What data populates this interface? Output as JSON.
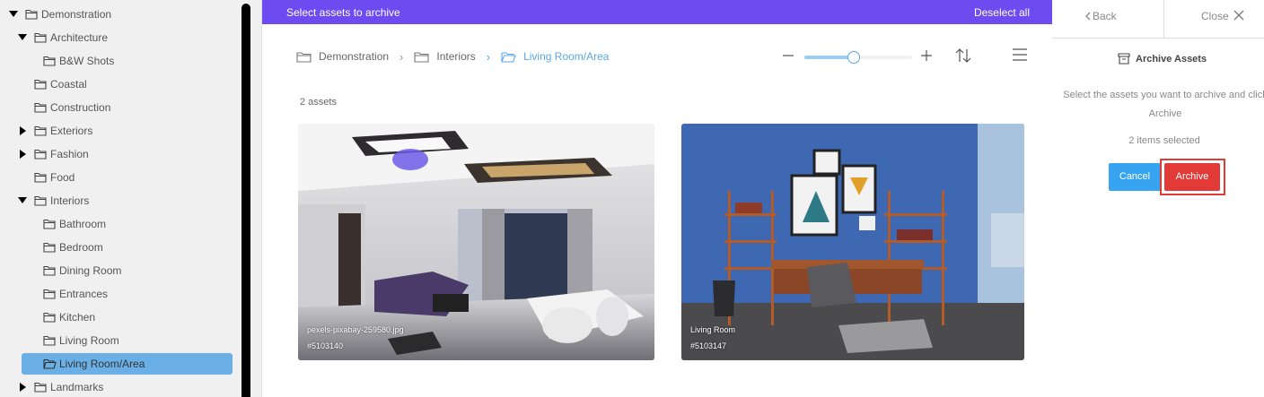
{
  "tree": {
    "items": [
      {
        "label": "Demonstration",
        "caret": "down"
      },
      {
        "label": "Architecture",
        "caret": "down"
      },
      {
        "label": "B&W Shots",
        "caret": ""
      },
      {
        "label": "Coastal",
        "caret": ""
      },
      {
        "label": "Construction",
        "caret": ""
      },
      {
        "label": "Exteriors",
        "caret": "right"
      },
      {
        "label": "Fashion",
        "caret": "right"
      },
      {
        "label": "Food",
        "caret": ""
      },
      {
        "label": "Interiors",
        "caret": "down"
      },
      {
        "label": "Bathroom",
        "caret": ""
      },
      {
        "label": "Bedroom",
        "caret": ""
      },
      {
        "label": "Dining Room",
        "caret": ""
      },
      {
        "label": "Entrances",
        "caret": ""
      },
      {
        "label": "Kitchen",
        "caret": ""
      },
      {
        "label": "Living Room",
        "caret": ""
      },
      {
        "label": "Living Room/Area",
        "caret": "",
        "selected": true
      },
      {
        "label": "Landmarks",
        "caret": "right"
      }
    ]
  },
  "topbar": {
    "title": "Select assets to archive",
    "deselect": "Deselect all",
    "color": "#6c4cf0"
  },
  "breadcrumb": [
    {
      "label": "Demonstration"
    },
    {
      "label": "Interiors"
    },
    {
      "label": "Living Room/Area",
      "active": true
    }
  ],
  "zoom": {
    "level": 0.45
  },
  "asset_count": "2 assets",
  "assets": [
    {
      "name": "pexels-pixabay-259580.jpg",
      "id": "#5103140",
      "selected": true
    },
    {
      "name": "Living Room",
      "id": "#5103147",
      "selected": true
    }
  ],
  "right": {
    "back": "Back",
    "close": "Close",
    "title": "Archive Assets",
    "instructions": "Select the assets you want to archive and click Archive",
    "selected": "2 items selected",
    "cancel": "Cancel",
    "archive": "Archive",
    "colors": {
      "cancel": "#36a4f0",
      "archive": "#e23a36"
    }
  }
}
